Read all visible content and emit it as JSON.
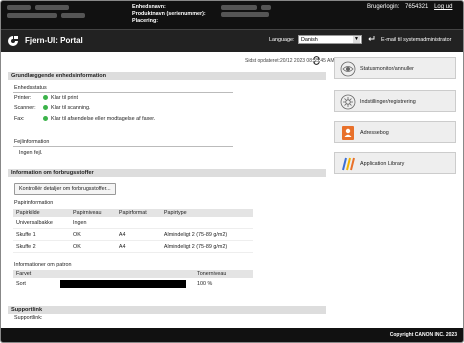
{
  "device": {
    "labels": [
      "Enhedsnavn:",
      "Produktnavn (serienummer):",
      "Placering:"
    ]
  },
  "login": {
    "label": "Brugerlogin:",
    "user_id": "7654321",
    "logout": "Log ud"
  },
  "header": {
    "title": "Fjern-UI: Portal",
    "language_label": "Language:",
    "language_value": "Danish",
    "mail_link": "E-mail til systemadministrator"
  },
  "status": {
    "last_updated": "Sidst opdateret:20/12 2023 08:55:45 AM"
  },
  "basic": {
    "heading": "Grundlæggende enhedsinformation",
    "device_status_heading": "Enhedsstatus",
    "rows": [
      {
        "name": "Printer:",
        "value": "Klar til print"
      },
      {
        "name": "Scanner:",
        "value": "Klar til scanning."
      },
      {
        "name": "Fax:",
        "value": "Klar til afsendelse eller modtagelse af faxer."
      }
    ],
    "error_heading": "Fejlinformation",
    "error_value": "Ingen fejl."
  },
  "consumables": {
    "heading": "Information om forbrugsstoffer",
    "check_button": "Kontrollér detaljer om forbrugsstoffer...",
    "paper_heading": "Papirinformation",
    "paper_columns": [
      "Papirkilde",
      "Papirniveau",
      "Papirformat",
      "Papirtype"
    ],
    "paper_rows": [
      [
        "Universalbakke",
        "Ingen",
        "",
        ""
      ],
      [
        "Skuffe 1",
        "OK",
        "A4",
        "Almindeligt 2 (75-89 g/m2)"
      ],
      [
        "Skuffe 2",
        "OK",
        "A4",
        "Almindeligt 2 (75-89 g/m2)"
      ]
    ],
    "toner_heading": "Informationer om patron",
    "toner_columns": [
      "Farvet",
      "Tonerniveau"
    ],
    "toner_rows": [
      {
        "color": "Sort",
        "level_text": "100 %",
        "level": 1.0
      }
    ]
  },
  "support": {
    "heading": "Supportlink",
    "label": "Supportlink:"
  },
  "sidebar": {
    "items": [
      {
        "label": "Statusmonitor/annuller",
        "icon": "status-monitor-icon"
      },
      {
        "label": "Indstillinger/registrering",
        "icon": "settings-icon"
      },
      {
        "label": "Adressebog",
        "icon": "address-book-icon"
      },
      {
        "label": "Application Library",
        "icon": "application-library-icon"
      }
    ]
  },
  "footer": {
    "copyright": "Copyright CANON INC. 2023"
  }
}
